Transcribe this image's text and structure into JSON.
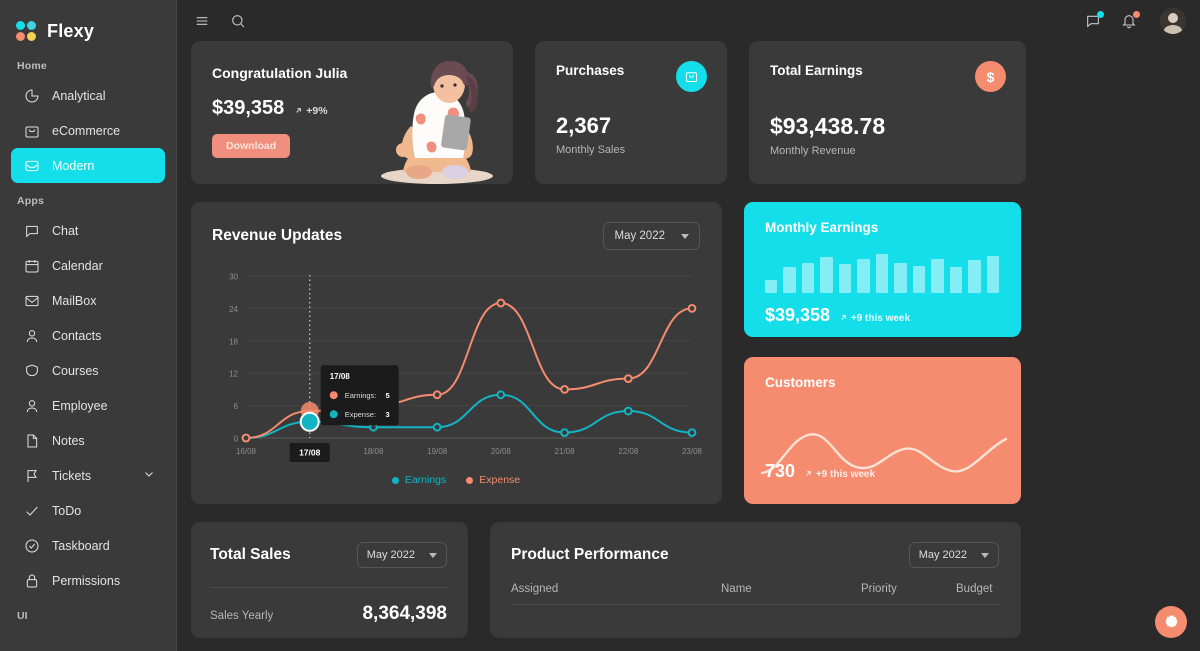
{
  "brand": {
    "name": "Flexy",
    "logo_icon": "flexy-logo"
  },
  "sidebar": {
    "sections": [
      {
        "label": "Home",
        "items": [
          {
            "label": "Analytical",
            "icon": "pie-chart-icon",
            "active": false
          },
          {
            "label": "eCommerce",
            "icon": "shopping-bag-icon",
            "active": false
          },
          {
            "label": "Modern",
            "icon": "inbox-icon",
            "active": true
          }
        ]
      },
      {
        "label": "Apps",
        "items": [
          {
            "label": "Chat",
            "icon": "chat-bubble-icon",
            "active": false
          },
          {
            "label": "Calendar",
            "icon": "calendar-icon",
            "active": false
          },
          {
            "label": "MailBox",
            "icon": "envelope-icon",
            "active": false
          },
          {
            "label": "Contacts",
            "icon": "user-icon",
            "active": false
          },
          {
            "label": "Courses",
            "icon": "graduation-cap-icon",
            "active": false
          },
          {
            "label": "Employee",
            "icon": "user-icon",
            "active": false
          },
          {
            "label": "Notes",
            "icon": "file-icon",
            "active": false
          },
          {
            "label": "Tickets",
            "icon": "flag-icon",
            "active": false,
            "caret": "chevron-down-icon"
          },
          {
            "label": "ToDo",
            "icon": "check-icon",
            "active": false
          },
          {
            "label": "Taskboard",
            "icon": "check-circle-icon",
            "active": false
          },
          {
            "label": "Permissions",
            "icon": "lock-icon",
            "active": false
          }
        ]
      }
    ],
    "cut_label": "UI"
  },
  "topbar": {
    "menu_icon": "hamburger-menu-icon",
    "search_icon": "search-icon",
    "chat_icon": "chat-bubble-icon",
    "bell_icon": "bell-icon",
    "chat_badge_color": "#13deea",
    "bell_badge_color": "#f58b6f",
    "avatar_icon": "user-avatar"
  },
  "congrat": {
    "title": "Congratulation Julia",
    "amount": "$39,358",
    "delta": "+9%",
    "delta_icon": "arrow-up-right-icon",
    "button_label": "Download",
    "illustration": "seated-woman-illustration"
  },
  "purchases": {
    "title": "Purchases",
    "value": "2,367",
    "subtitle": "Monthly Sales",
    "icon": "shopping-bag-icon",
    "accent": "#13deea"
  },
  "total_earnings": {
    "title": "Total Earnings",
    "value": "$93,438.78",
    "subtitle": "Monthly Revenue",
    "icon": "dollar-icon",
    "accent": "#f58b6f"
  },
  "revenue": {
    "title": "Revenue Updates",
    "period": "May 2022",
    "dropdown_icon": "chevron-down-icon",
    "tooltip": {
      "date": "17/08",
      "rows": [
        {
          "label": "Earnings:",
          "value": "5",
          "color": "#f58b6f"
        },
        {
          "label": "Expense:",
          "value": "3",
          "color": "#13b4c4"
        }
      ]
    },
    "highlight_label": "17/08"
  },
  "chart_data": {
    "type": "line",
    "title": "Revenue Updates",
    "x": [
      "16/08",
      "17/08",
      "18/08",
      "19/08",
      "20/08",
      "21/08",
      "22/08",
      "23/08"
    ],
    "series": [
      {
        "name": "Earnings",
        "color": "#13b4c4",
        "values": [
          0,
          3,
          2,
          2,
          8,
          1,
          5,
          1
        ]
      },
      {
        "name": "Expense",
        "color": "#f58b6f",
        "values": [
          0,
          5,
          6,
          8,
          25,
          9,
          11,
          24
        ]
      }
    ],
    "ylim": [
      0,
      30
    ],
    "yticks": [
      0,
      6,
      12,
      18,
      24,
      30
    ],
    "xlabel": "",
    "ylabel": "",
    "grid": true,
    "legend": "bottom"
  },
  "monthly_earnings": {
    "title": "Monthly Earnings",
    "amount": "$39,358",
    "delta": "+9 this week",
    "delta_icon": "arrow-up-right-icon",
    "bg": "#13deea",
    "bars": [
      30,
      62,
      72,
      85,
      68,
      80,
      92,
      72,
      64,
      82,
      62,
      78,
      88
    ]
  },
  "customers": {
    "title": "Customers",
    "amount": "730",
    "delta": "+9 this week",
    "delta_icon": "arrow-up-right-icon",
    "bg": "#f58b6f"
  },
  "total_sales": {
    "title": "Total Sales",
    "period": "May 2022",
    "dropdown_icon": "chevron-down-icon",
    "row_label": "Sales Yearly",
    "row_value": "8,364,398"
  },
  "product_performance": {
    "title": "Product Performance",
    "period": "May 2022",
    "dropdown_icon": "chevron-down-icon",
    "columns": [
      "Assigned",
      "Name",
      "Priority",
      "Budget"
    ]
  },
  "fab": {
    "icon": "gear-icon",
    "color": "#f58b6f"
  }
}
